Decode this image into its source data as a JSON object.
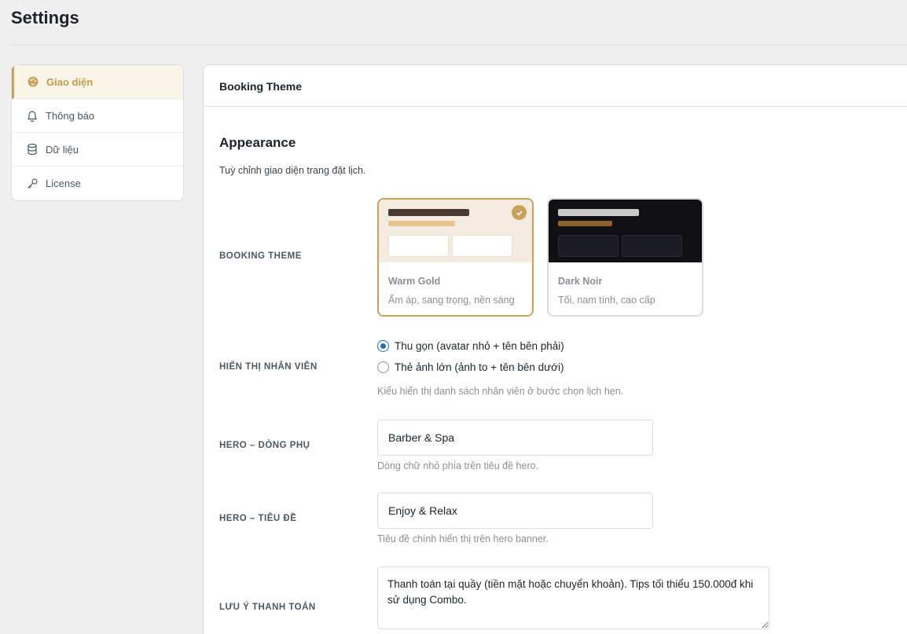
{
  "page": {
    "title": "Settings"
  },
  "sidebar": {
    "items": [
      {
        "label": "Giao diện",
        "icon": "palette-icon",
        "active": true
      },
      {
        "label": "Thông báo",
        "icon": "bell-icon",
        "active": false
      },
      {
        "label": "Dữ liệu",
        "icon": "database-icon",
        "active": false
      },
      {
        "label": "License",
        "icon": "key-icon",
        "active": false
      }
    ]
  },
  "panel": {
    "header": "Booking Theme",
    "section_title": "Appearance",
    "section_desc": "Tuỳ chỉnh giao diện trang đặt lịch."
  },
  "booking_theme": {
    "label": "BOOKING THEME",
    "options": [
      {
        "name": "Warm Gold",
        "desc": "Ấm áp, sang trọng, nền sáng",
        "selected": true
      },
      {
        "name": "Dark Noir",
        "desc": "Tối, nam tính, cao cấp",
        "selected": false
      }
    ]
  },
  "staff_display": {
    "label": "HIỂN THỊ NHÂN VIÊN",
    "options": [
      {
        "label": "Thu gọn (avatar nhỏ + tên bên phải)",
        "checked": true
      },
      {
        "label": "Thẻ ảnh lớn (ảnh to + tên bên dưới)",
        "checked": false
      }
    ],
    "help": "Kiểu hiển thị danh sách nhân viên ở bước chọn lịch hẹn."
  },
  "hero_subtitle": {
    "label": "HERO – DÒNG PHỤ",
    "value": "Barber & Spa",
    "help": "Dòng chữ nhỏ phía trên tiêu đề hero."
  },
  "hero_title": {
    "label": "HERO – TIÊU ĐỀ",
    "value": "Enjoy & Relax",
    "help": "Tiêu đề chính hiển thị trên hero banner."
  },
  "payment_note": {
    "label": "LƯU Ý THANH TOÁN",
    "value": "Thanh toán tại quầy (tiền mặt hoặc chuyển khoản). Tips tối thiểu 150.000đ khi sử dụng Combo."
  },
  "colors": {
    "accent": "#c9a25a",
    "active_bg": "#fbf5e8",
    "radio": "#2271b1"
  }
}
